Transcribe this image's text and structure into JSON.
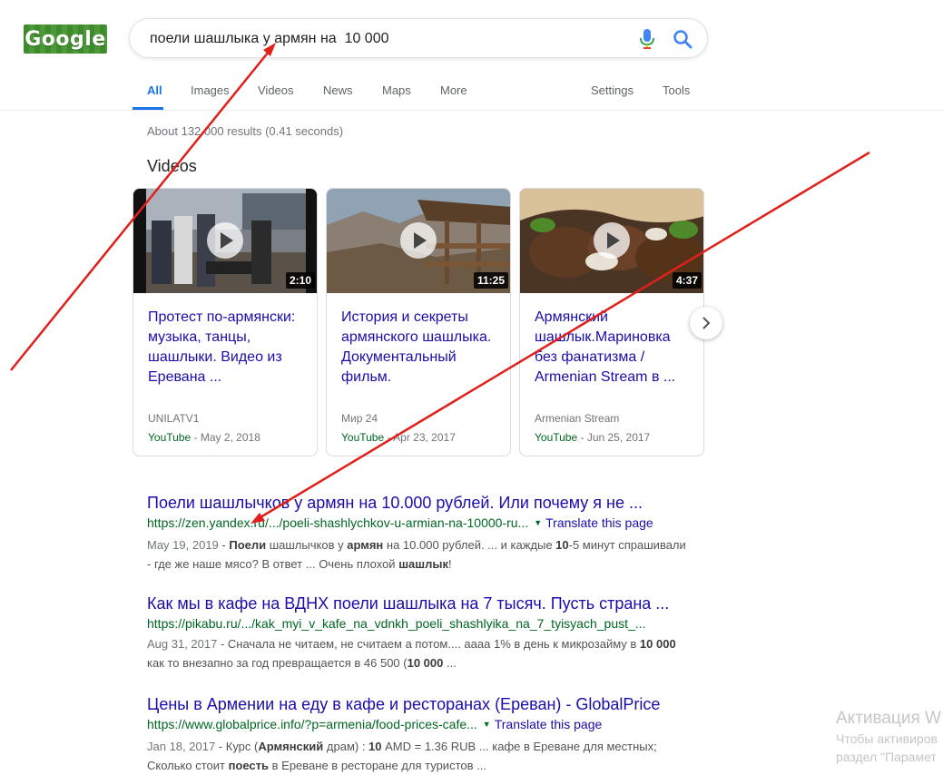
{
  "header": {
    "logo_text": "Google",
    "search_value": "поели шашлыка у армян на  10 000"
  },
  "tabs": [
    {
      "label": "All",
      "active": true
    },
    {
      "label": "Images"
    },
    {
      "label": "Videos"
    },
    {
      "label": "News"
    },
    {
      "label": "Maps"
    },
    {
      "label": "More"
    },
    {
      "label": "Settings"
    },
    {
      "label": "Tools"
    }
  ],
  "stats": "About 132 000 results (0.41 seconds)",
  "videos": {
    "heading": "Videos",
    "items": [
      {
        "title": "Протест по-армянски: музыка, танцы, шашлыки. Видео из Еревана ...",
        "duration": "2:10",
        "source": "UNILATV1",
        "platform": "YouTube",
        "date": " - May 2, 2018"
      },
      {
        "title": "История и секреты армянского шашлыка. Документальный фильм.",
        "duration": "11:25",
        "source": "Мир 24",
        "platform": "YouTube",
        "date": " - Apr 23, 2017"
      },
      {
        "title": "Армянский шашлык.Мариновка без фанатизма / Armenian Stream в ...",
        "duration": "4:37",
        "source": "Armenian Stream",
        "platform": "YouTube",
        "date": " - Jun 25, 2017"
      }
    ]
  },
  "results": [
    {
      "title": "Поели шашлычков у армян на 10.000 рублей. Или почему я не ...",
      "url": "https://zen.yandex.ru/.../poeli-shashlychkov-u-armian-na-10000-ru...",
      "translate": "Translate this page",
      "date": "May 19, 2019",
      "s1": " - ",
      "b1": "Поели",
      "s2": " шашлычков у ",
      "b2": "армян",
      "s3": " на 10.000 рублей. ... и каждые ",
      "b3": "10",
      "s4": "-5 минут спрашивали - где же наше мясо? В ответ ... Очень плохой ",
      "b4": "шашлык",
      "s5": "!"
    },
    {
      "title": "Как мы в кафе на ВДНХ поели шашлыка на 7 тысяч. Пусть страна ...",
      "url": "https://pikabu.ru/.../kak_myi_v_kafe_na_vdnkh_poeli_shashlyika_na_7_tyisyach_pust_...",
      "date": "Aug 31, 2017",
      "s1": " - Сначала не читаем, не считаем а потом.... аааа 1% в день к микрозайму в ",
      "b1": "10 000",
      "s2": " как то внезапно за год превращается в 46 500 (",
      "b2": "10 000",
      "s3": " ..."
    },
    {
      "title": "Цены в Армении на еду в кафе и ресторанах (Ереван) - GlobalPrice",
      "url": "https://www.globalprice.info/?p=armenia/food-prices-cafe...",
      "translate": "Translate this page",
      "date": "Jan 18, 2017",
      "s1": " - Курс (",
      "b1": "Армянский",
      "s2": " драм) : ",
      "b2": "10",
      "s3": " AMD = 1.36 RUB ... кафе в Ереване для местных; Сколько стоит ",
      "b3": "поесть",
      "s4": " в Ереване в ресторане для туристов ..."
    }
  ],
  "watermark": {
    "line1": "Активация W",
    "line2": "Чтобы активиров",
    "line3": "раздел \"Парамет"
  },
  "colors": {
    "link": "#1a0dab",
    "url_green": "#006621",
    "accent_blue": "#1a73e8",
    "annotation_red": "#e0201b"
  }
}
